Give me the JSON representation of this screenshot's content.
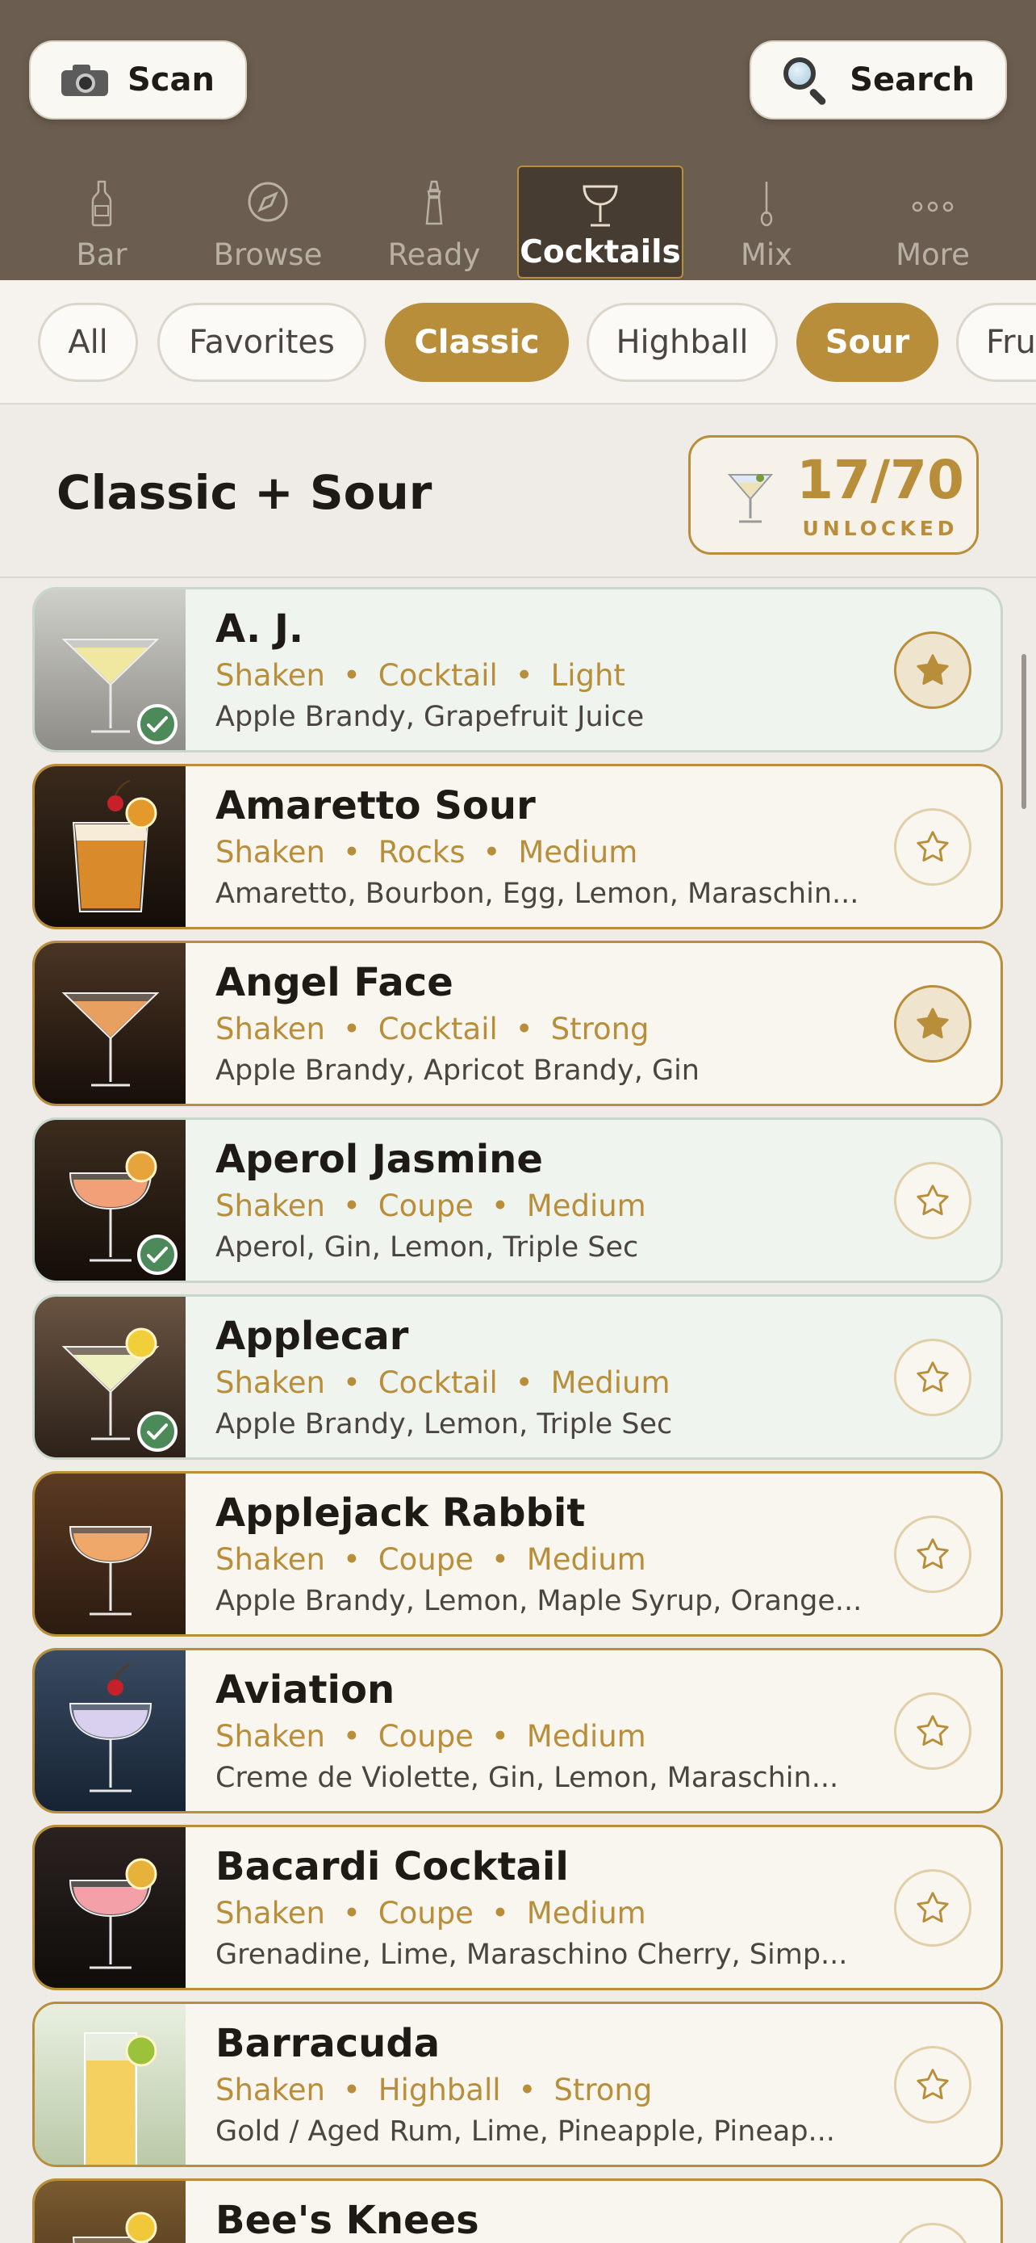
{
  "header": {
    "scan_label": "Scan",
    "search_label": "Search",
    "tabs": [
      {
        "label": "Bar",
        "icon": "bottle-icon"
      },
      {
        "label": "Browse",
        "icon": "compass-icon"
      },
      {
        "label": "Ready",
        "icon": "shaker-icon"
      },
      {
        "label": "Cocktails",
        "icon": "coupe-glass-icon",
        "active": true
      },
      {
        "label": "Mix",
        "icon": "bar-spoon-icon"
      },
      {
        "label": "More",
        "icon": "more-dots-icon"
      }
    ]
  },
  "filters": [
    {
      "label": "All",
      "selected": false
    },
    {
      "label": "Favorites",
      "selected": false
    },
    {
      "label": "Classic",
      "selected": true
    },
    {
      "label": "Highball",
      "selected": false
    },
    {
      "label": "Sour",
      "selected": true
    },
    {
      "label": "Fruity",
      "selected": false
    }
  ],
  "section": {
    "title": "Classic + Sour",
    "count": "17/70",
    "count_label": "UNLOCKED"
  },
  "colors": {
    "accent": "#b88e3a",
    "header_bg": "#6b5e51",
    "page_bg": "#efebe6",
    "check_green": "#4d8a5a"
  },
  "cocktails": [
    {
      "name": "A. J.",
      "method": "Shaken",
      "glass": "Cocktail",
      "strength": "Light",
      "ingredients": "Apple Brandy, Grapefruit Juice",
      "favorite": true,
      "unlocked": true
    },
    {
      "name": "Amaretto Sour",
      "method": "Shaken",
      "glass": "Rocks",
      "strength": "Medium",
      "ingredients": "Amaretto, Bourbon, Egg, Lemon, Maraschin...",
      "favorite": false,
      "unlocked": false
    },
    {
      "name": "Angel Face",
      "method": "Shaken",
      "glass": "Cocktail",
      "strength": "Strong",
      "ingredients": "Apple Brandy, Apricot Brandy, Gin",
      "favorite": true,
      "unlocked": false
    },
    {
      "name": "Aperol Jasmine",
      "method": "Shaken",
      "glass": "Coupe",
      "strength": "Medium",
      "ingredients": "Aperol, Gin, Lemon, Triple Sec",
      "favorite": false,
      "unlocked": true
    },
    {
      "name": "Applecar",
      "method": "Shaken",
      "glass": "Cocktail",
      "strength": "Medium",
      "ingredients": "Apple Brandy, Lemon, Triple Sec",
      "favorite": false,
      "unlocked": true
    },
    {
      "name": "Applejack Rabbit",
      "method": "Shaken",
      "glass": "Coupe",
      "strength": "Medium",
      "ingredients": "Apple Brandy, Lemon, Maple Syrup, Orange...",
      "favorite": false,
      "unlocked": false
    },
    {
      "name": "Aviation",
      "method": "Shaken",
      "glass": "Coupe",
      "strength": "Medium",
      "ingredients": "Creme de Violette, Gin, Lemon, Maraschin...",
      "favorite": false,
      "unlocked": false
    },
    {
      "name": "Bacardi Cocktail",
      "method": "Shaken",
      "glass": "Coupe",
      "strength": "Medium",
      "ingredients": "Grenadine, Lime, Maraschino Cherry, Simp...",
      "favorite": false,
      "unlocked": false
    },
    {
      "name": "Barracuda",
      "method": "Shaken",
      "glass": "Highball",
      "strength": "Strong",
      "ingredients": "Gold / Aged Rum, Lime, Pineapple, Pineap...",
      "favorite": false,
      "unlocked": false
    },
    {
      "name": "Bee's Knees",
      "method": "",
      "glass": "",
      "strength": "",
      "ingredients": "",
      "favorite": false,
      "unlocked": false
    }
  ]
}
